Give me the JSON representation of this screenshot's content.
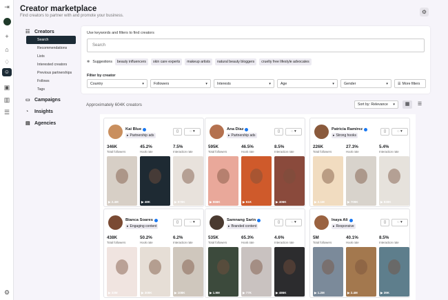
{
  "header": {
    "title": "Creator marketplace",
    "subtitle": "Find creators to partner with and promote your business."
  },
  "nav": {
    "creators": "Creators",
    "creator_subs": [
      "Search",
      "Recommendations",
      "Lists",
      "Interested creators",
      "Previous partnerships",
      "Follows",
      "Tags"
    ],
    "campaigns": "Campaigns",
    "insights": "Insights",
    "agencies": "Agencies"
  },
  "search": {
    "label": "Use keywords and filters to find creators",
    "placeholder": "Search"
  },
  "suggestions": {
    "label": "Suggestions",
    "chips": [
      "beauty influencers",
      "skin care experts",
      "makeup artists",
      "natural beauty bloggers",
      "cruelty free lifestyle advocates"
    ]
  },
  "filter": {
    "label": "Filter by creator",
    "dropdowns": [
      "Country",
      "Followers",
      "Interests",
      "Age",
      "Gender"
    ],
    "more": "More filters"
  },
  "results": {
    "count": "Approximately 604K creators",
    "sort": "Sort by: Relevance"
  },
  "stat_labels": [
    "Total followers",
    "Hook rate",
    "Interaction rate"
  ],
  "creators": [
    {
      "name": "Kai Blue",
      "badge": "Partnership ads",
      "stats": [
        "346K",
        "45.2%",
        "7.5%"
      ],
      "counts": [
        "2.4M",
        "48K",
        "878K"
      ]
    },
    {
      "name": "Ana Díaz",
      "badge": "Partnership ads",
      "stats": [
        "595K",
        "46.5%",
        "8.5%"
      ],
      "counts": [
        "556K",
        "61K",
        "406K"
      ]
    },
    {
      "name": "Patricia Ramírez",
      "badge": "Strong hooks",
      "stats": [
        "226K",
        "27.3%",
        "5.4%"
      ],
      "counts": [
        "2.1M",
        "709K",
        "838K"
      ]
    },
    {
      "name": "Bianca Soares",
      "badge": "Engaging content",
      "stats": [
        "438K",
        "50.2%",
        "6.2%"
      ],
      "counts": [
        "33M",
        "308K",
        "108K"
      ]
    },
    {
      "name": "Samnang Sarin",
      "badge": "Branded content",
      "stats": [
        "535K",
        "65.3%",
        "4.6%"
      ],
      "counts": [
        "1.9M",
        "77K",
        "486K"
      ]
    },
    {
      "name": "Inaya Ali",
      "badge": "Responsive",
      "stats": [
        "5M",
        "40.1%",
        "8.5%"
      ],
      "counts": [
        "1.2M",
        "2.4M",
        "39K"
      ]
    }
  ]
}
